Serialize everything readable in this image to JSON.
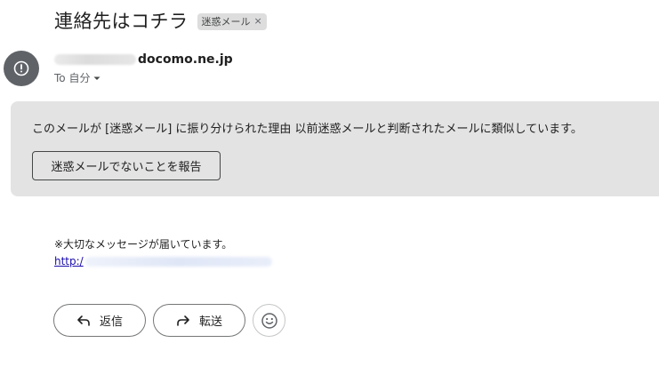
{
  "email": {
    "subject": "連絡先はコチラ",
    "label_chip": {
      "text": "迷惑メール",
      "close": "×"
    },
    "sender": {
      "domain_visible": "docomo.ne.jp"
    },
    "recipient_summary": "To 自分",
    "avatar_icon": "alert-circle-icon"
  },
  "spam_notice": {
    "reason": "このメールが [迷惑メール] に振り分けられた理由 以前迷惑メールと判断されたメールに類似しています。",
    "report_button": "迷惑メールでないことを報告"
  },
  "body": {
    "line1": "※大切なメッセージが届いています。",
    "link_prefix": "http:/"
  },
  "actions": {
    "reply": {
      "label": "返信",
      "icon": "reply-arrow-icon"
    },
    "forward": {
      "label": "転送",
      "icon": "forward-arrow-icon"
    },
    "emoji": {
      "icon": "emoji-smile-icon"
    }
  },
  "colors": {
    "spam_banner_bg": "#e3e3e3",
    "avatar_bg": "#5f6368",
    "link": "#1a0dab"
  }
}
